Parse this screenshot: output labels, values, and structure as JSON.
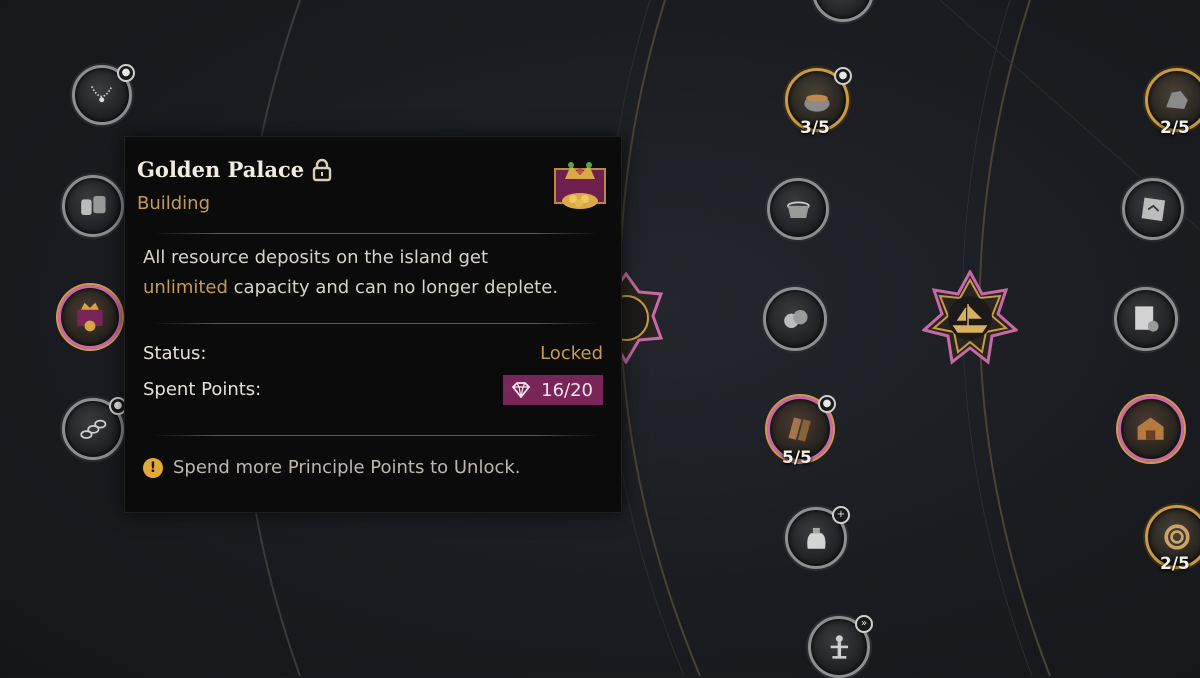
{
  "tooltip": {
    "title": "Golden Palace",
    "lock_icon": "padlock-icon",
    "subtitle": "Building",
    "emblem_icon": "golden-palace-crown-icon",
    "description_part1": "All resource deposits on the island get",
    "description_highlight": "unlimited",
    "description_part2": " capacity and can no longer deplete.",
    "status_label": "Status:",
    "status_value": "Locked",
    "spent_points_label": "Spent Points:",
    "spent_points_value": "16/20",
    "points_icon": "principle-gem-icon",
    "hint_icon": "exclamation-icon",
    "hint": "Spend more Principle Points to Unlock."
  },
  "nodes": {
    "necklace": {
      "icon": "necklace-icon"
    },
    "barrels": {
      "icon": "barrels-icon"
    },
    "golden_palace": {
      "icon": "golden-palace-icon"
    },
    "chain": {
      "icon": "chain-icon"
    },
    "pottery": {
      "icon": "pottery-icon",
      "count": "3/5"
    },
    "washtub": {
      "icon": "washtub-icon"
    },
    "coins": {
      "icon": "coins-icon"
    },
    "cloth": {
      "icon": "cloth-icon",
      "count": "5/5"
    },
    "flour": {
      "icon": "flour-sack-icon"
    },
    "training_dummy": {
      "icon": "training-dummy-icon"
    },
    "ship_center": {
      "icon": "ship-icon"
    },
    "ship_left": {
      "icon": "ship-icon"
    },
    "ore": {
      "icon": "ore-icon",
      "count": "2/5"
    },
    "map": {
      "icon": "map-icon"
    },
    "wanted": {
      "icon": "wanted-poster-icon"
    },
    "warehouse": {
      "icon": "warehouse-icon"
    },
    "rope": {
      "icon": "rope-icon",
      "count": "2/5"
    },
    "top_partial": {
      "icon": "partial-node-icon"
    }
  },
  "colors": {
    "accent_gold": "#c79a55",
    "points_purple": "#7a2559",
    "node_pink": "#c66aa6",
    "warning_yellow": "#e2a93a"
  }
}
